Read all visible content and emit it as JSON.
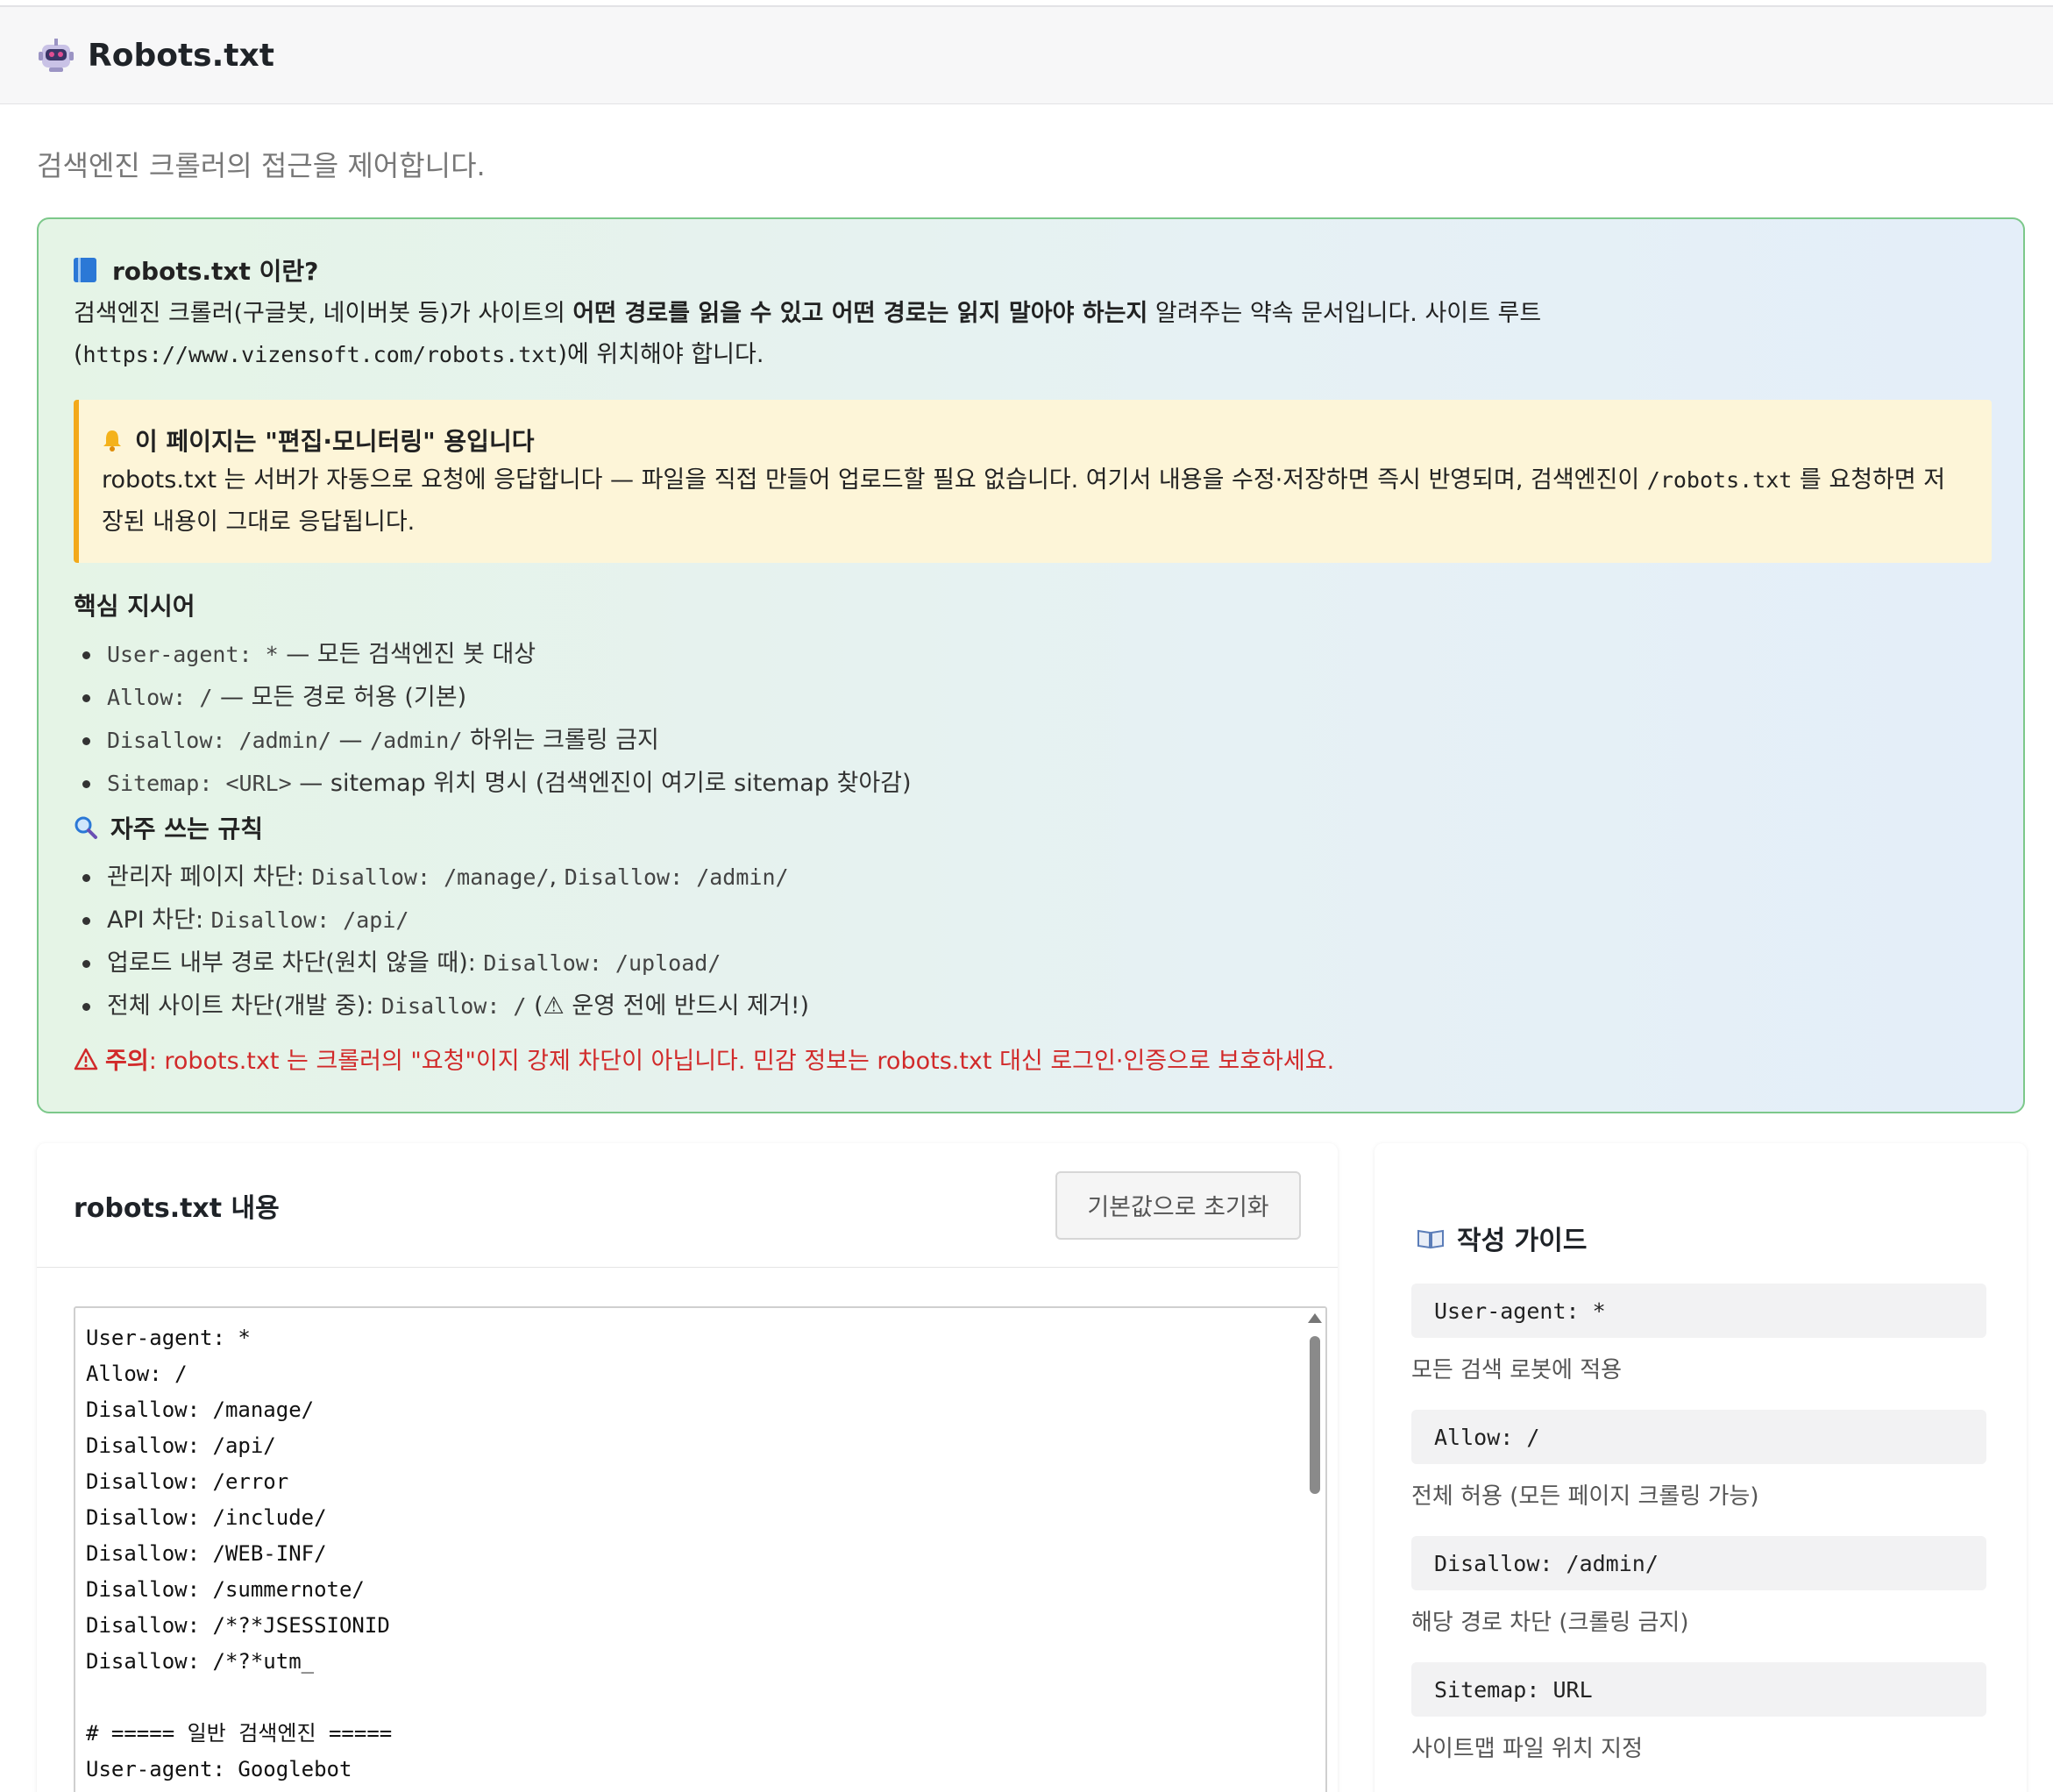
{
  "header": {
    "title": "Robots.txt",
    "icon": "robot-icon"
  },
  "subtitle": "검색엔진 크롤러의 접근을 제어합니다.",
  "info": {
    "title": "robots.txt 이란?",
    "body_1": "검색엔진 크롤러(구글봇, 네이버봇 등)가 사이트의 ",
    "body_bold": "어떤 경로를 읽을 수 있고 어떤 경로는 읽지 말아야 하는지",
    "body_2": " 알려주는 약속 문서입니다. 사이트 루트",
    "body_3_open": "(",
    "body_url": "https://www.vizensoft.com/robots.txt",
    "body_3_close": ")에 위치해야 합니다.",
    "notice": {
      "title": "이 페이지는 \"편집·모니터링\" 용입니다",
      "body_1": "robots.txt 는 서버가 자동으로 요청에 응답합니다 — 파일을 직접 만들어 업로드할 필요 없습니다. 여기서 내용을 수정·저장하면 즉시 반영되며, 검색엔진이 ",
      "body_code": "/robots.txt",
      "body_2": " 를 요청하면 저",
      "body_3": "장된 내용이 그대로 응답됩니다."
    },
    "directives_title": "핵심 지시어",
    "directives": [
      {
        "code": "User-agent: *",
        "text": " — 모든 검색엔진 봇 대상"
      },
      {
        "code": "Allow: /",
        "text": " — 모든 경로 허용 (기본)"
      },
      {
        "code": "Disallow: /admin/",
        "text": " — ",
        "code2": "/admin/",
        "text2": " 하위는 크롤링 금지"
      },
      {
        "code": "Sitemap: <URL>",
        "text": " — sitemap 위치 명시 (검색엔진이 여기로 sitemap 찾아감)"
      }
    ],
    "rules_title": "자주 쓰는 규칙",
    "rules": [
      {
        "text": "관리자 페이지 차단: ",
        "code": "Disallow: /manage/",
        "sep": ", ",
        "code2": "Disallow: /admin/",
        "text2": ""
      },
      {
        "text": "API 차단: ",
        "code": "Disallow: /api/",
        "sep": "",
        "code2": "",
        "text2": ""
      },
      {
        "text": "업로드 내부 경로 차단(원치 않을 때): ",
        "code": "Disallow: /upload/",
        "sep": "",
        "code2": "",
        "text2": ""
      },
      {
        "text": "전체 사이트 차단(개발 중): ",
        "code": "Disallow: /",
        "sep": "",
        "code2": "",
        "text2": " (⚠ 운영 전에 반드시 제거!)"
      }
    ],
    "warning_label": "주의",
    "warning_text": ": robots.txt 는 크롤러의 \"요청\"이지 강제 차단이 아닙니다. 민감 정보는 robots.txt 대신 로그인·인증으로 보호하세요."
  },
  "editor": {
    "title": "robots.txt 내용",
    "reset_label": "기본값으로 초기화",
    "lines": [
      "User-agent: *",
      "Allow: /",
      "Disallow: /manage/",
      "Disallow: /api/",
      "Disallow: /error",
      "Disallow: /include/",
      "Disallow: /WEB-INF/",
      "Disallow: /summernote/",
      "Disallow: /*?*JSESSIONID",
      "Disallow: /*?*utm_",
      "",
      "# ===== 일반 검색엔진 =====",
      "User-agent: Googlebot"
    ]
  },
  "guide": {
    "title": "작성 가이드",
    "items": [
      {
        "code": "User-agent: *",
        "desc": "모든 검색 로봇에 적용"
      },
      {
        "code": "Allow: /",
        "desc": "전체 허용 (모든 페이지 크롤링 가능)"
      },
      {
        "code": "Disallow: /admin/",
        "desc": "해당 경로 차단 (크롤링 금지)"
      },
      {
        "code": "Sitemap: URL",
        "desc": "사이트맵 파일 위치 지정"
      }
    ]
  },
  "colors": {
    "info_border": "#7cc88a",
    "notice_accent": "#f3a91a",
    "warning": "#d12a2a"
  }
}
